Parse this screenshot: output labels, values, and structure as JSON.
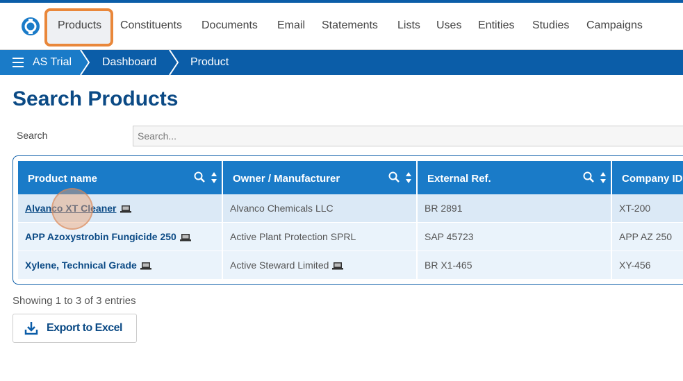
{
  "nav": {
    "items": [
      "Products",
      "Constituents",
      "Documents",
      "Email",
      "Statements",
      "Lists",
      "Uses",
      "Entities",
      "Studies",
      "Campaigns"
    ],
    "active": "Products"
  },
  "breadcrumb": {
    "items": [
      "AS Trial",
      "Dashboard",
      "Product"
    ]
  },
  "page": {
    "title": "Search Products"
  },
  "search": {
    "label": "Search",
    "placeholder": "Search..."
  },
  "table": {
    "columns": [
      "Product name",
      "Owner / Manufacturer",
      "External Ref.",
      "Company ID"
    ],
    "rows": [
      [
        "Alvanco XT Cleaner",
        "Alvanco Chemicals LLC",
        "BR 2891",
        "XT-200"
      ],
      [
        "APP Azoxystrobin Fungicide 250",
        "Active Plant Protection SPRL",
        "SAP 45723",
        "APP AZ 250"
      ],
      [
        "Xylene, Technical Grade",
        "Active Steward Limited",
        "BR X1-465",
        "XY-456"
      ]
    ]
  },
  "footer": {
    "showing": "Showing 1 to 3 of 3 entries",
    "export_label": "Export to Excel"
  },
  "colors": {
    "brand_dark": "#0b5da8",
    "brand_light": "#1a7bc8",
    "title": "#0b4a85",
    "highlight": "#e9873a"
  },
  "icons": {
    "logo": "app-logo",
    "menu": "hamburger-icon",
    "column_search": "search-icon",
    "sort": "sort-icon",
    "device": "laptop-icon",
    "export": "download-icon"
  }
}
